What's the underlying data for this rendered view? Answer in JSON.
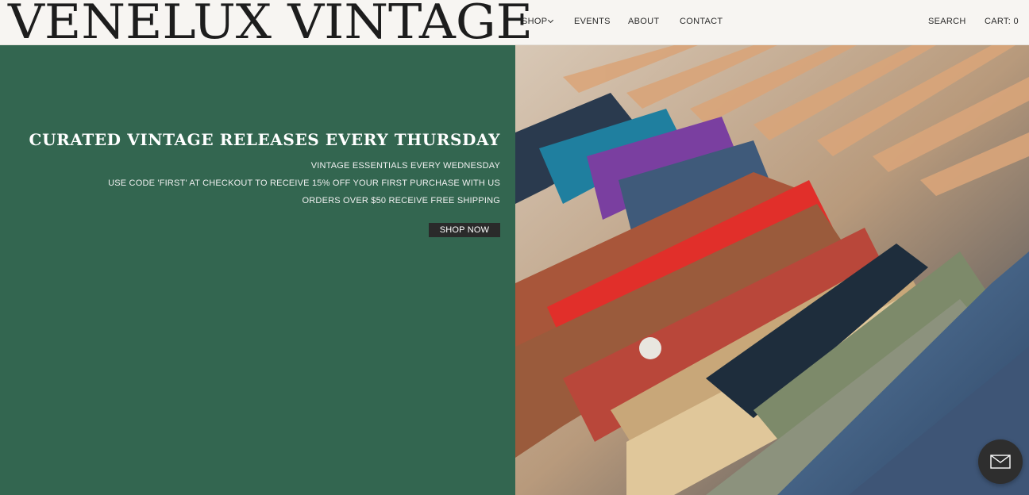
{
  "header": {
    "logo": "VENELUX VINTAGE",
    "nav": {
      "shop": "SHOP",
      "events": "EVENTS",
      "about": "ABOUT",
      "contact": "CONTACT"
    },
    "search": "SEARCH",
    "cart": "CART: 0"
  },
  "hero": {
    "heading": "CURATED VINTAGE RELEASES EVERY THURSDAY",
    "lines": [
      "VINTAGE ESSENTIALS EVERY WEDNESDAY",
      "USE CODE 'FIRST' AT CHECKOUT TO RECEIVE 15% OFF YOUR FIRST PURCHASE WITH US",
      "ORDERS OVER $50 RECEIVE FREE SHIPPING"
    ],
    "cta": "SHOP NOW",
    "bg_color": "#336650",
    "image": "clothing-rack-photo"
  },
  "floating": {
    "icon": "mail-icon"
  }
}
